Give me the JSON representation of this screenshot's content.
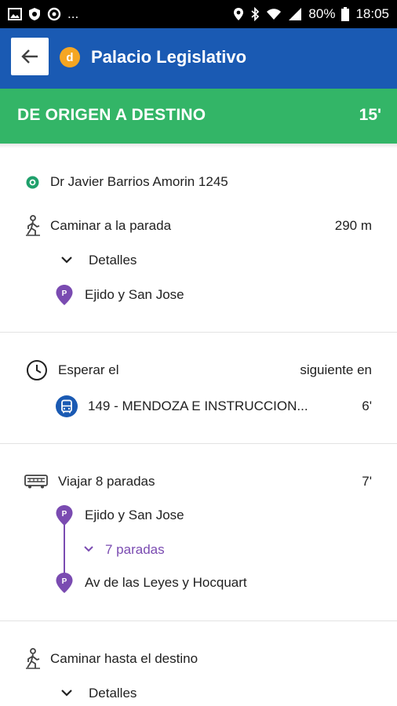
{
  "status_bar": {
    "battery": "80%",
    "time": "18:05",
    "more": "..."
  },
  "app_bar": {
    "badge": "d",
    "title": "Palacio Legislativo"
  },
  "route": {
    "title": "DE ORIGEN A DESTINO",
    "duration": "15'"
  },
  "origin": {
    "address": "Dr Javier Barrios Amorin 1245"
  },
  "walk_to_stop": {
    "label": "Caminar a la parada",
    "distance": "290 m",
    "details": "Detalles",
    "stop_badge": "P",
    "stop": "Ejido y San Jose"
  },
  "wait": {
    "label": "Esperar el",
    "next_label": "siguiente en",
    "line": "149 - MENDOZA E INSTRUCCION...",
    "eta": "6'"
  },
  "ride": {
    "label": "Viajar 8 paradas",
    "duration": "7'",
    "start_badge": "P",
    "start_stop": "Ejido y San Jose",
    "stops_toggle": "7 paradas",
    "end_badge": "P",
    "end_stop": "Av de las Leyes y Hocquart"
  },
  "walk_to_destination": {
    "label": "Caminar hasta el destino",
    "details": "Detalles"
  },
  "colors": {
    "app_bar": "#1a5ab3",
    "route_bar": "#33b567",
    "badge": "#f5a623",
    "stop_purple": "#7a4bb1",
    "bus_blue": "#1a5ab3"
  }
}
